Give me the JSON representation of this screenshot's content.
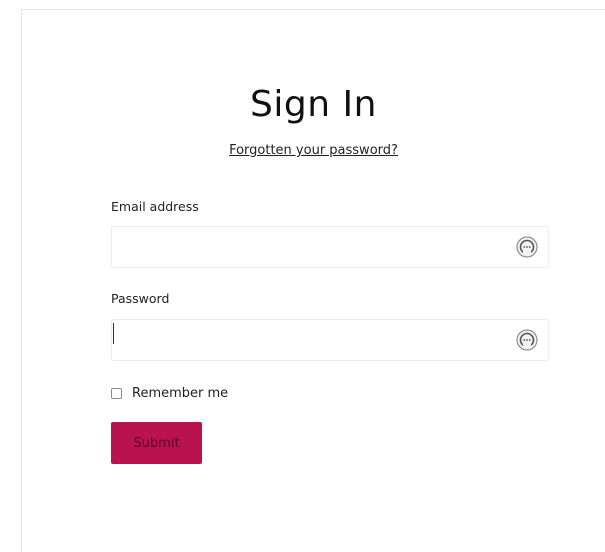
{
  "form": {
    "title": "Sign In",
    "forgot_link": "Forgotten your password?",
    "email_label": "Email address",
    "email_value": "",
    "password_label": "Password",
    "password_value": "",
    "password_manager_icon": "password-manager-icon",
    "remember_label": "Remember me",
    "remember_checked": false,
    "submit_label": "Submit"
  },
  "colors": {
    "submit_bg": "#b8134f",
    "submit_text": "#5e0626",
    "border": "#ececec",
    "text": "#1f1f1f"
  }
}
